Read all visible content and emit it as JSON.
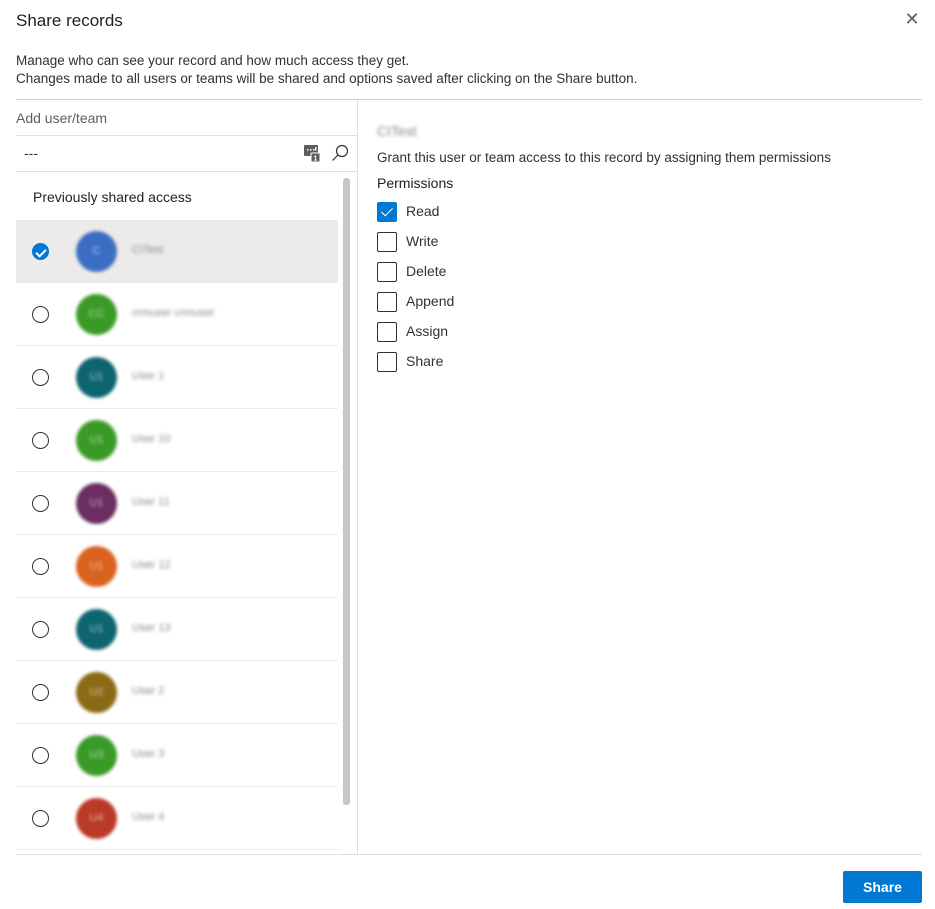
{
  "dialog": {
    "title": "Share records",
    "close_icon": "✕",
    "description_line1": "Manage who can see your record and how much access they get.",
    "description_line2": "Changes made to all users or teams will be shared and options saved after clicking on the Share button."
  },
  "left_panel": {
    "add_label": "Add user/team",
    "search_value": "---",
    "search_placeholder": "",
    "list_header": "Previously shared access",
    "users": [
      {
        "initials": "C",
        "name": "CITest",
        "color": "#3b6dc4",
        "selected": true
      },
      {
        "initials": "CC",
        "name": "crmuser crmuser",
        "color": "#3a9a28",
        "selected": false
      },
      {
        "initials": "U1",
        "name": "User 1",
        "color": "#0e6470",
        "selected": false
      },
      {
        "initials": "U1",
        "name": "User 10",
        "color": "#3a9a28",
        "selected": false
      },
      {
        "initials": "U1",
        "name": "User 11",
        "color": "#6b2d62",
        "selected": false
      },
      {
        "initials": "U1",
        "name": "User 12",
        "color": "#d9621f",
        "selected": false
      },
      {
        "initials": "U1",
        "name": "User 13",
        "color": "#0e6470",
        "selected": false
      },
      {
        "initials": "U2",
        "name": "User 2",
        "color": "#8a6a14",
        "selected": false
      },
      {
        "initials": "U3",
        "name": "User 3",
        "color": "#3a9a28",
        "selected": false
      },
      {
        "initials": "U4",
        "name": "User 4",
        "color": "#b93a26",
        "selected": false
      }
    ]
  },
  "right_panel": {
    "selected_name": "CITest",
    "grant_text": "Grant this user or team access to this record by assigning them permissions",
    "permissions_label": "Permissions",
    "permissions": [
      {
        "label": "Read",
        "checked": true
      },
      {
        "label": "Write",
        "checked": false
      },
      {
        "label": "Delete",
        "checked": false
      },
      {
        "label": "Append",
        "checked": false
      },
      {
        "label": "Assign",
        "checked": false
      },
      {
        "label": "Share",
        "checked": false
      }
    ]
  },
  "footer": {
    "share_label": "Share"
  },
  "colors": {
    "accent": "#0078d4",
    "selected_row": "#edebe9"
  }
}
